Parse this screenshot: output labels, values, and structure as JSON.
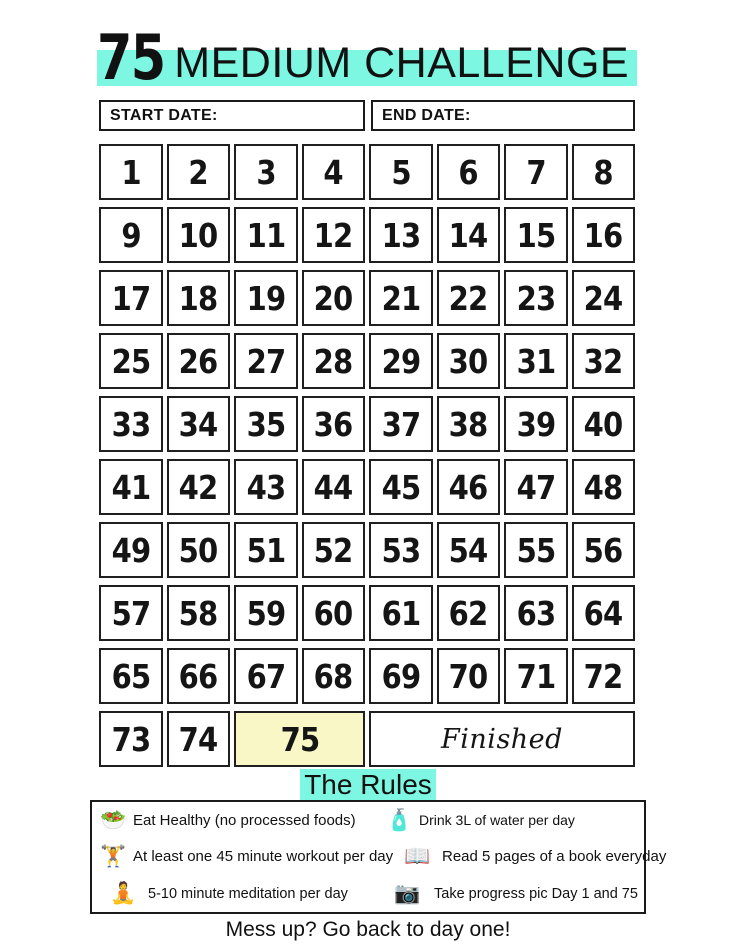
{
  "title": {
    "number": "75",
    "rest": "MEDIUM CHALLENGE",
    "highlight_color": "#7DF7E2"
  },
  "dates": {
    "start_label": "START DATE:",
    "start_value": "",
    "end_label": "END DATE:",
    "end_value": ""
  },
  "grid": {
    "days": [
      "1",
      "2",
      "3",
      "4",
      "5",
      "6",
      "7",
      "8",
      "9",
      "10",
      "11",
      "12",
      "13",
      "14",
      "15",
      "16",
      "17",
      "18",
      "19",
      "20",
      "21",
      "22",
      "23",
      "24",
      "25",
      "26",
      "27",
      "28",
      "29",
      "30",
      "31",
      "32",
      "33",
      "34",
      "35",
      "36",
      "37",
      "38",
      "39",
      "40",
      "41",
      "42",
      "43",
      "44",
      "45",
      "46",
      "47",
      "48",
      "49",
      "50",
      "51",
      "52",
      "53",
      "54",
      "55",
      "56",
      "57",
      "58",
      "59",
      "60",
      "61",
      "62",
      "63",
      "64",
      "65",
      "66",
      "67",
      "68",
      "69",
      "70",
      "71",
      "72",
      "73",
      "74"
    ],
    "final_day": "75",
    "final_day_color": "#FAF7C6",
    "finished_label": "Finished"
  },
  "rules": {
    "heading": "The Rules",
    "heading_highlight_color": "#7DF7E2",
    "items_left": [
      {
        "icon": "salad-icon",
        "glyph": "🥗",
        "text": "Eat Healthy  (no processed foods)"
      },
      {
        "icon": "weightlifter-icon",
        "glyph": "🏋️",
        "text": "At least one 45 minute workout per day"
      },
      {
        "icon": "meditation-icon",
        "glyph": "🧘",
        "text": "5-10 minute meditation per day"
      }
    ],
    "items_right": [
      {
        "icon": "water-bottle-icon",
        "glyph": "🧴",
        "text": "Drink 3L of water per day"
      },
      {
        "icon": "open-book-icon",
        "glyph": "📖",
        "text": "Read 5 pages of a book everyday"
      },
      {
        "icon": "camera-icon",
        "glyph": "📷",
        "text": "Take progress pic Day 1 and 75"
      }
    ]
  },
  "footer": {
    "text": "Mess up? Go back to day one!"
  }
}
